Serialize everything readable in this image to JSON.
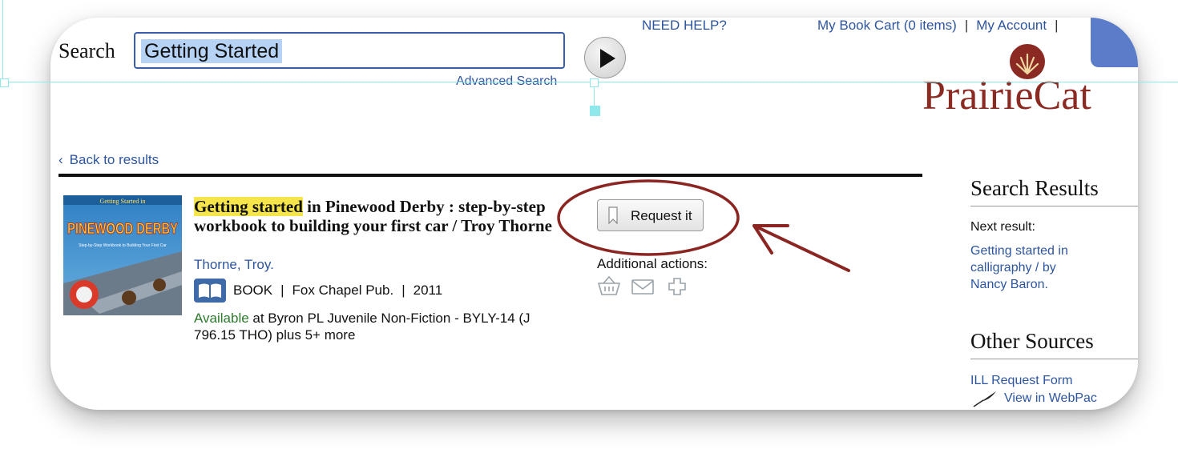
{
  "header": {
    "need_help": "NEED HELP?",
    "cart": "My Book Cart (0 items)",
    "separator": "|",
    "account": "My Account"
  },
  "search": {
    "label": "Search",
    "value": "Getting Started",
    "advanced": "Advanced Search"
  },
  "logo": {
    "text": "PrairieCat"
  },
  "nav": {
    "back": "Back to results"
  },
  "record": {
    "title_highlight": "Getting started",
    "title_rest": " in Pinewood Derby : step-by-step workbook to building your first car / Troy Thorne",
    "author": "Thorne, Troy.",
    "format": "BOOK",
    "publisher": "Fox Chapel Pub.",
    "year": "2011",
    "available_label": "Available",
    "available_rest": " at Byron PL Juvenile Non-Fiction - BYLY-14 (J 796.15 THO) plus 5+ more",
    "cover_title_top": "Getting Started in",
    "cover_title_main": "PINEWOOD DERBY",
    "cover_subtitle": "Step-by-Step Workbook to Building Your First Car"
  },
  "actions": {
    "request": "Request it",
    "additional": "Additional actions:",
    "icons": [
      "basket-icon",
      "email-icon",
      "plus-icon"
    ]
  },
  "sidebar": {
    "search_results_heading": "Search Results",
    "next_result_label": "Next result:",
    "next_result_link": "Getting started in calligraphy / by Nancy Baron.",
    "other_sources_heading": "Other Sources",
    "ill_link": "ILL Request Form",
    "webpac_link": "View in WebPac"
  },
  "colors": {
    "link": "#2d55a0",
    "brand": "#8b2a23",
    "highlight": "#f6e44b",
    "annotation": "#8b2522",
    "available": "#2c7a2c"
  }
}
